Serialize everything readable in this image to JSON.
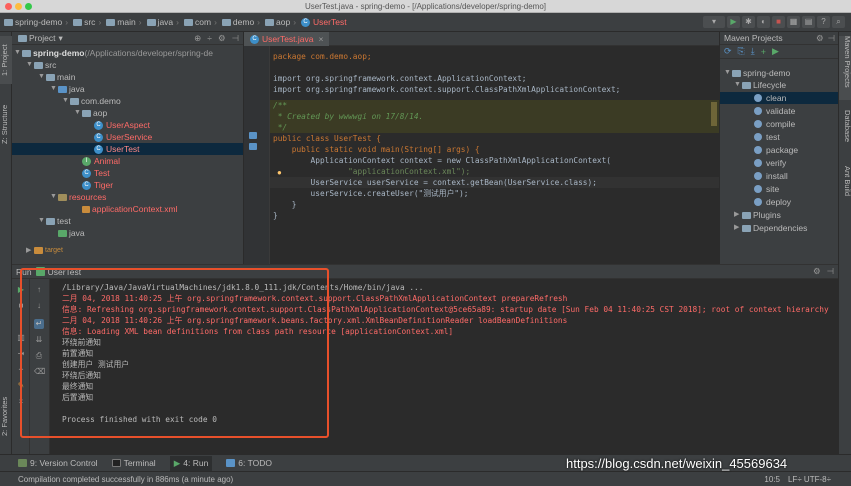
{
  "window": {
    "title": "UserTest.java - spring-demo - [/Applications/developer/spring-demo]"
  },
  "breadcrumbs": [
    "spring-demo",
    "src",
    "main",
    "java",
    "com",
    "demo",
    "aop",
    "UserTest"
  ],
  "project_panel": {
    "header": "Project",
    "tree": [
      {
        "label": "spring-demo",
        "suffix": " (/Applications/developer/spring-de"
      },
      {
        "label": "src"
      },
      {
        "label": "main"
      },
      {
        "label": "java"
      },
      {
        "label": "com.demo"
      },
      {
        "label": "aop"
      },
      {
        "label": "UserAspect"
      },
      {
        "label": "UserService"
      },
      {
        "label": "UserTest"
      },
      {
        "label": "Animal"
      },
      {
        "label": "Test"
      },
      {
        "label": "Tiger"
      },
      {
        "label": "resources"
      },
      {
        "label": "applicationContext.xml"
      },
      {
        "label": "test"
      },
      {
        "label": "java"
      },
      {
        "label": "target"
      }
    ]
  },
  "editor": {
    "tab": "UserTest.java",
    "lines": [
      "package com.demo.aop;",
      "",
      "import org.springframework.context.ApplicationContext;",
      "import org.springframework.context.support.ClassPathXmlApplicationContext;",
      "",
      "/**",
      " * Created by wwwwgi on 17/8/14.",
      " */",
      "public class UserTest {",
      "    public static void main(String[] args) {",
      "        ApplicationContext context = new ClassPathXmlApplicationContext(",
      "                \"applicationContext.xml\");",
      "        UserService userService = context.getBean(UserService.class);",
      "        userService.createUser(\"测试用户\");",
      "    }",
      "}"
    ]
  },
  "maven_panel": {
    "header": "Maven Projects",
    "project": "spring-demo",
    "lifecycle": "Lifecycle",
    "goals": [
      "clean",
      "validate",
      "compile",
      "test",
      "package",
      "verify",
      "install",
      "site",
      "deploy"
    ],
    "plugins": "Plugins",
    "dependencies": "Dependencies"
  },
  "run_panel": {
    "tab_prefix": "Run",
    "tab": "UserTest",
    "output": [
      {
        "text": "/Library/Java/JavaVirtualMachines/jdk1.8.0_111.jdk/Contents/Home/bin/java ...",
        "color": "wht"
      },
      {
        "text": "二月 04, 2018 11:40:25 上午 org.springframework.context.support.ClassPathXmlApplicationContext prepareRefresh",
        "color": "red"
      },
      {
        "text": "信息: Refreshing org.springframework.context.support.ClassPathXmlApplicationContext@5ce65a89: startup date [Sun Feb 04 11:40:25 CST 2018]; root of context hierarchy",
        "color": "red"
      },
      {
        "text": "二月 04, 2018 11:40:26 上午 org.springframework.beans.factory.xml.XmlBeanDefinitionReader loadBeanDefinitions",
        "color": "red"
      },
      {
        "text": "信息: Loading XML bean definitions from class path resource [applicationContext.xml]",
        "color": "red"
      },
      {
        "text": "环绕前通知",
        "color": "wht"
      },
      {
        "text": "前置通知",
        "color": "wht"
      },
      {
        "text": "创建用户 测试用户",
        "color": "wht"
      },
      {
        "text": "环绕后通知",
        "color": "wht"
      },
      {
        "text": "最终通知",
        "color": "wht"
      },
      {
        "text": "后置通知",
        "color": "wht"
      },
      {
        "text": "",
        "color": "wht"
      },
      {
        "text": "Process finished with exit code 0",
        "color": "wht"
      }
    ]
  },
  "left_strip": {
    "project": "1: Project",
    "structure": "Z: Structure",
    "favorites": "2: Favorites"
  },
  "right_strip": {
    "maven": "Maven Projects",
    "database": "Database",
    "ant": "Ant Build"
  },
  "bottom_tabs": [
    "9: Version Control",
    "Terminal",
    "4: Run",
    "6: TODO"
  ],
  "status": {
    "message": "Compilation completed successfully in 886ms (a minute ago)",
    "position": "10:5",
    "encoding": "LF÷  UTF-8÷"
  },
  "watermark": "https://blog.csdn.net/weixin_45569634"
}
